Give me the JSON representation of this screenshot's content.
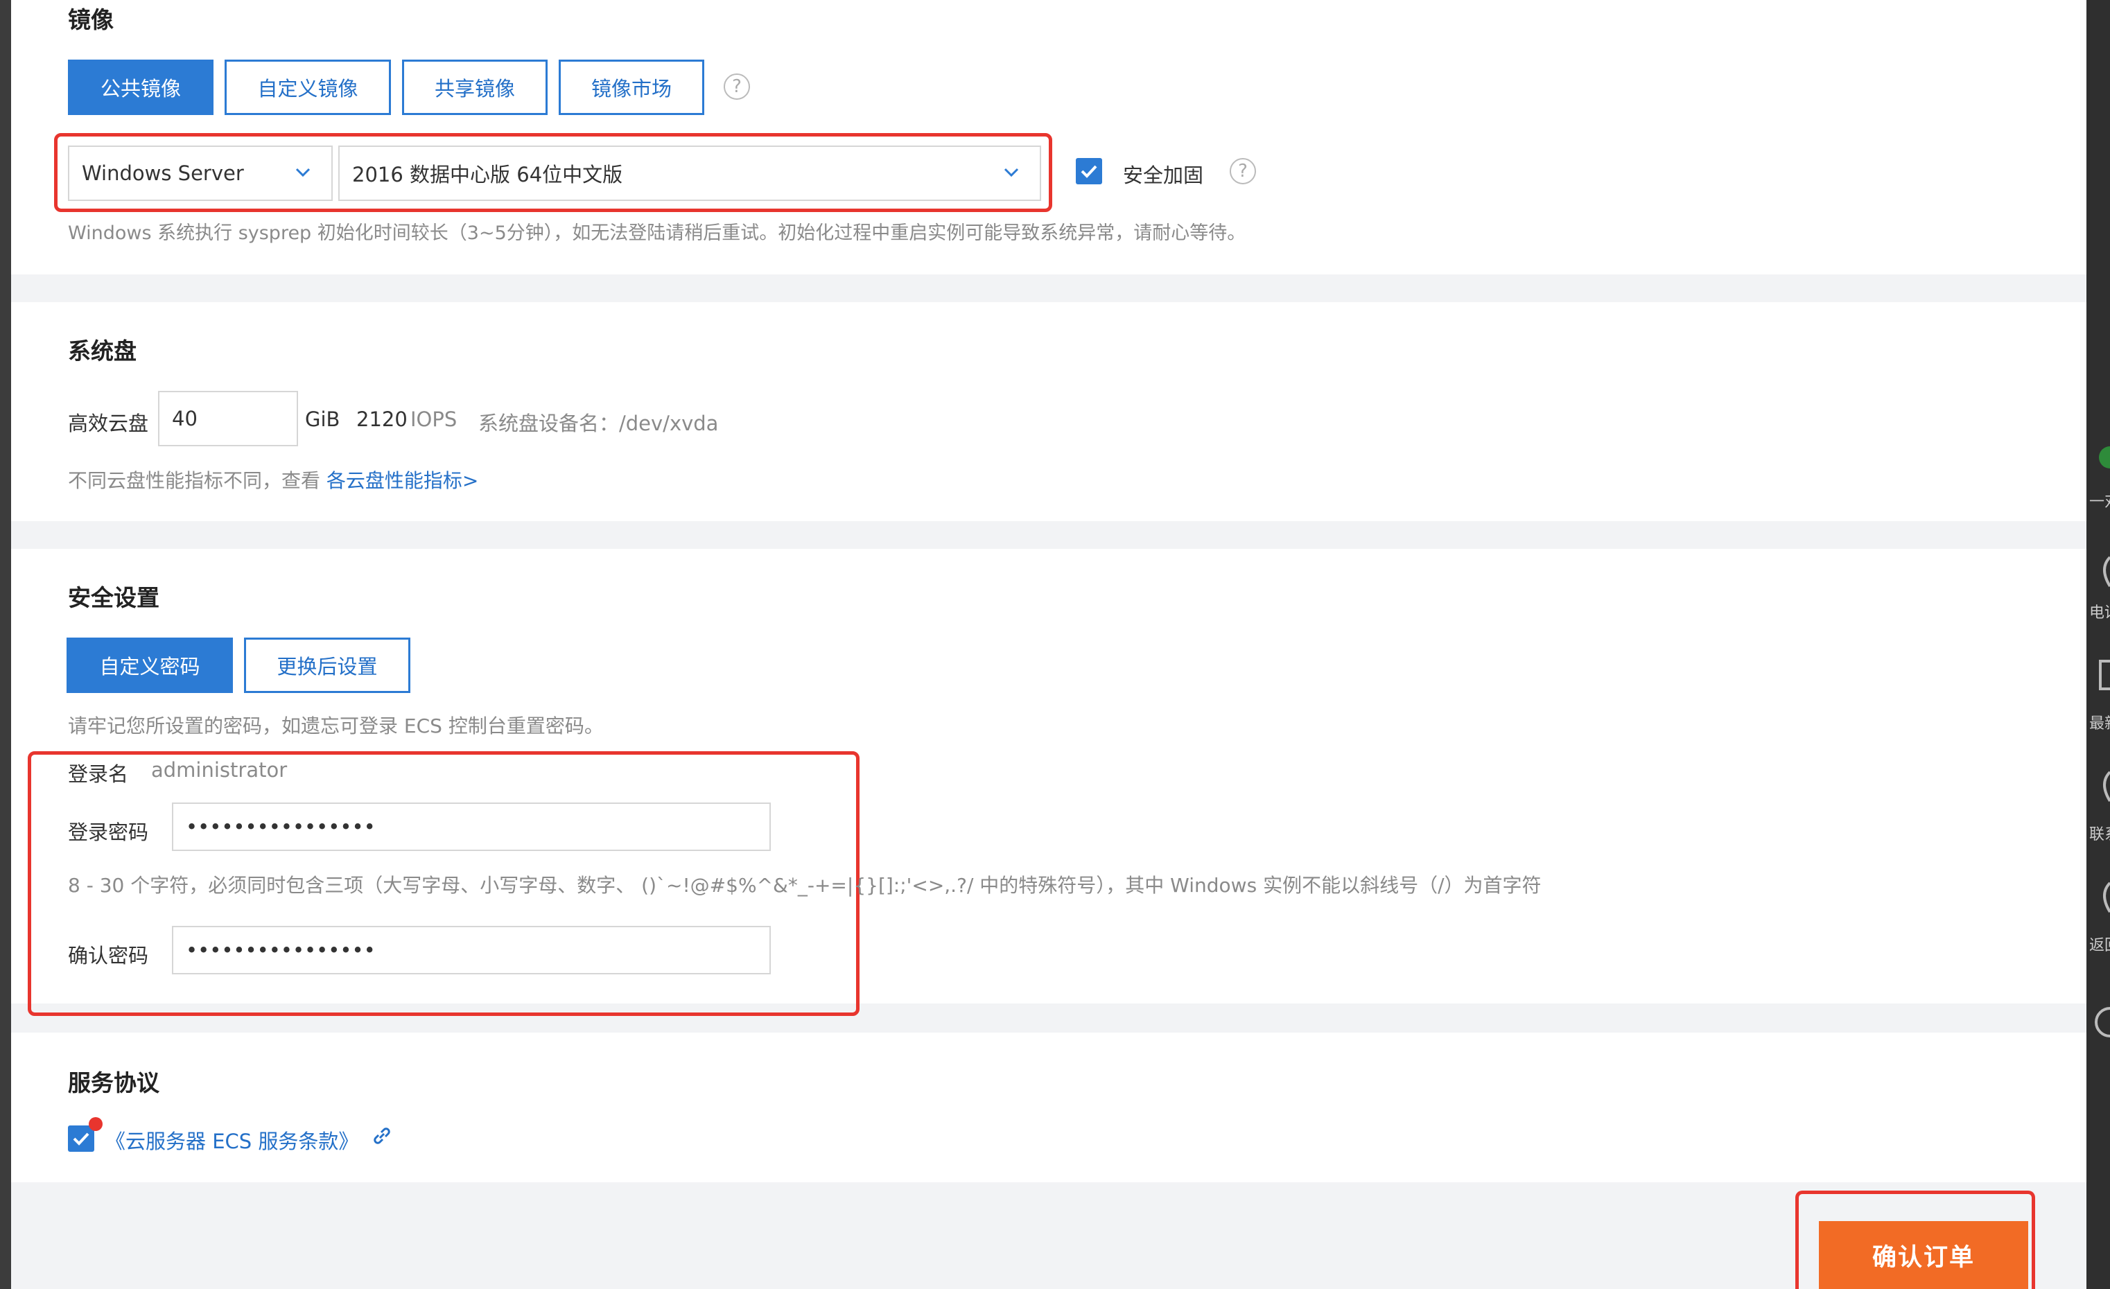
{
  "image_section": {
    "title": "镜像",
    "tabs": [
      {
        "label": "公共镜像",
        "active": true
      },
      {
        "label": "自定义镜像",
        "active": false
      },
      {
        "label": "共享镜像",
        "active": false
      },
      {
        "label": "镜像市场",
        "active": false
      }
    ],
    "os_select": {
      "value": "Windows Server"
    },
    "version_select": {
      "value": "2016 数据中心版 64位中文版"
    },
    "security_harden_label": "安全加固",
    "hint": "Windows 系统执行 sysprep 初始化时间较长（3~5分钟），如无法登陆请稍后重试。初始化过程中重启实例可能导致系统异常，请耐心等待。"
  },
  "system_disk": {
    "title": "系统盘",
    "type_label": "高效云盘",
    "size_value": "40",
    "unit": "GiB",
    "iops_value": "2120",
    "iops_label": "IOPS",
    "device_label": "系统盘设备名：/dev/xvda",
    "perf_hint": "不同云盘性能指标不同，查看",
    "perf_link": "各云盘性能指标>"
  },
  "security": {
    "title": "安全设置",
    "tabs": [
      {
        "label": "自定义密码",
        "active": true
      },
      {
        "label": "更换后设置",
        "active": false
      }
    ],
    "remember_hint": "请牢记您所设置的密码，如遗忘可登录 ECS 控制台重置密码。",
    "login_name_label": "登录名",
    "login_name_value": "administrator",
    "password_label": "登录密码",
    "password_value": "••••••••••••••••",
    "password_rule": "8 - 30 个字符，必须同时包含三项（大写字母、小写字母、数字、 ()`~!@#$%^&*_-+=|{}[]:;'<>,.?/ 中的特殊符号），其中 Windows 实例不能以斜线号（/）为首字符",
    "confirm_label": "确认密码",
    "confirm_value": "••••••••••••••••"
  },
  "agreement": {
    "title": "服务协议",
    "link_text": "《云服务器 ECS 服务条款》"
  },
  "footer": {
    "confirm_button": "确认订单"
  },
  "right_rail": {
    "labels": [
      "一对",
      "电话",
      "最新",
      "联系",
      "返回"
    ]
  },
  "colors": {
    "primary": "#2c7bd4",
    "link": "#2470c8",
    "highlight_red": "#e8352e",
    "order_orange": "#f26b25"
  }
}
